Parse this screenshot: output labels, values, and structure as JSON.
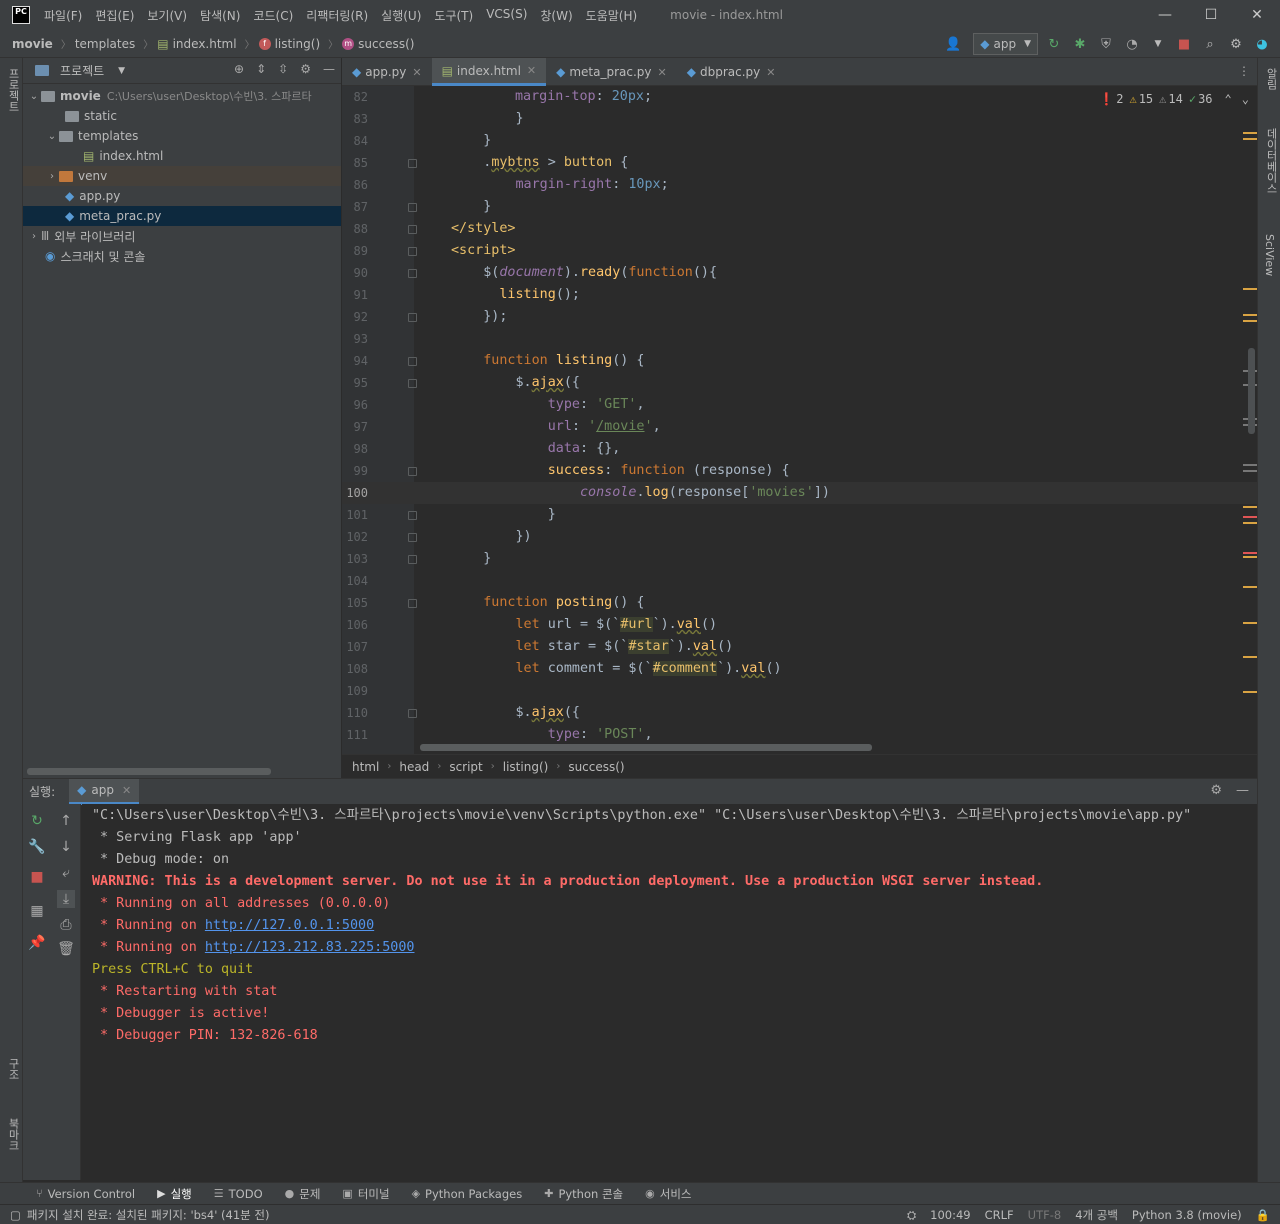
{
  "app": {
    "logo_text": "PC",
    "window_title": "movie - index.html",
    "menu": [
      "파일(F)",
      "편집(E)",
      "보기(V)",
      "탐색(N)",
      "코드(C)",
      "리팩터링(R)",
      "실행(U)",
      "도구(T)",
      "VCS(S)",
      "창(W)",
      "도움말(H)"
    ]
  },
  "breadcrumb": [
    "movie",
    "templates",
    "index.html",
    "listing()",
    "success()"
  ],
  "run_config": "app",
  "left_strip": {
    "project": "프로젝트",
    "structure": "구조",
    "bookmarks": "북마크"
  },
  "right_strip": {
    "notifications": "알림",
    "database": "데이터베이스",
    "sciview": "SciView"
  },
  "project_panel": {
    "title": "프로젝트",
    "tree": [
      {
        "label": "movie",
        "path": "C:\\Users\\user\\Desktop\\수빈\\3. 스파르타",
        "type": "folder",
        "depth": 0,
        "expanded": true
      },
      {
        "label": "static",
        "type": "folder",
        "depth": 1
      },
      {
        "label": "templates",
        "type": "folder",
        "depth": 1,
        "expanded": true
      },
      {
        "label": "index.html",
        "type": "html",
        "depth": 2
      },
      {
        "label": "venv",
        "type": "folder-orange",
        "depth": 1,
        "collapsed": true
      },
      {
        "label": "app.py",
        "type": "py",
        "depth": 1
      },
      {
        "label": "meta_prac.py",
        "type": "py",
        "depth": 1,
        "selected": true
      },
      {
        "label": "외부 라이브러리",
        "type": "lib",
        "depth": 0,
        "collapsed": true
      },
      {
        "label": "스크래치 및 콘솔",
        "type": "scratch",
        "depth": 0
      }
    ]
  },
  "tabs": [
    {
      "label": "app.py",
      "active": false
    },
    {
      "label": "index.html",
      "active": true
    },
    {
      "label": "meta_prac.py",
      "active": false
    },
    {
      "label": "dbprac.py",
      "active": false
    }
  ],
  "inspections": {
    "errors": "2",
    "warnings": "15",
    "weak_warnings": "14",
    "typos": "36"
  },
  "editor": {
    "current_line": "100",
    "line_numbers": [
      "82",
      "83",
      "84",
      "85",
      "86",
      "87",
      "88",
      "89",
      "90",
      "91",
      "92",
      "93",
      "94",
      "95",
      "96",
      "97",
      "98",
      "99",
      "100",
      "101",
      "102",
      "103",
      "104",
      "105",
      "106",
      "107",
      "108",
      "109",
      "110",
      "111"
    ]
  },
  "editor_breadcrumb": [
    "html",
    "head",
    "script",
    "listing()",
    "success()"
  ],
  "run_panel": {
    "label": "실행:",
    "tab": "app",
    "lines": [
      {
        "text": "\"C:\\Users\\user\\Desktop\\수빈\\3. 스파르타\\projects\\movie\\venv\\Scripts\\python.exe\" \"C:\\Users\\user\\Desktop\\수빈\\3. 스파르타\\projects\\movie\\app.py\"",
        "style": "norm"
      },
      {
        "text": " * Serving Flask app 'app'",
        "style": "norm"
      },
      {
        "text": " * Debug mode: on",
        "style": "norm"
      },
      {
        "text": "WARNING: This is a development server. Do not use it in a production deployment. Use a production WSGI server instead.",
        "style": "warn"
      },
      {
        "text": " * Running on all addresses (0.0.0.0)",
        "style": "red"
      },
      {
        "prefix": " * Running on ",
        "link": "http://127.0.0.1:5000",
        "style": "red"
      },
      {
        "prefix": " * Running on ",
        "link": "http://123.212.83.225:5000",
        "style": "red"
      },
      {
        "text": "Press CTRL+C to quit",
        "style": "yel"
      },
      {
        "text": " * Restarting with stat",
        "style": "red"
      },
      {
        "text": " * Debugger is active!",
        "style": "red"
      },
      {
        "text": " * Debugger PIN: 132-826-618",
        "style": "red"
      }
    ]
  },
  "tool_tabs": [
    "Version Control",
    "실행",
    "TODO",
    "문제",
    "터미널",
    "Python Packages",
    "Python 콘솔",
    "서비스"
  ],
  "status": {
    "message": "패키지 설치 완료: 설치된 패키지: 'bs4' (41분 전)",
    "position": "100:49",
    "line_sep": "CRLF",
    "encoding": "UTF-8",
    "indent": "4개 공백",
    "interpreter": "Python 3.8 (movie)"
  }
}
